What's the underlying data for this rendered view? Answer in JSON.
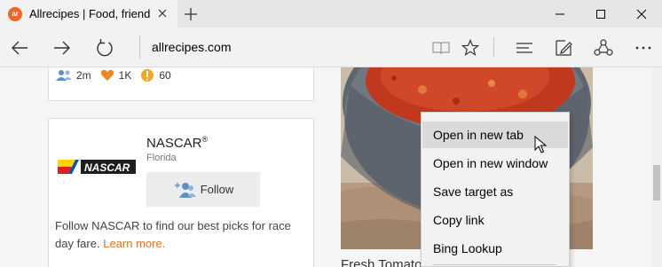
{
  "browser": {
    "tab": {
      "favicon": "allrecipes-logo-icon",
      "title": "Allrecipes | Food, friend"
    },
    "window_controls": [
      "minimize",
      "maximize",
      "close"
    ],
    "address": "allrecipes.com",
    "toolbar_icons": [
      "back-icon",
      "forward-icon",
      "refresh-icon",
      "reading-view-icon",
      "favorites-star-icon",
      "hub-icon",
      "web-note-icon",
      "share-icon",
      "more-icon"
    ]
  },
  "page": {
    "top_card_stats": [
      {
        "icon": "followers-icon",
        "value": "2m"
      },
      {
        "icon": "heart-icon",
        "value": "1K"
      },
      {
        "icon": "badge-icon",
        "value": "60"
      }
    ],
    "brand_card": {
      "logo_text": "NASCAR",
      "name": "NASCAR",
      "trademark": "®",
      "location": "Florida",
      "follow_label": "Follow",
      "description": "Follow NASCAR to find our best picks for race day fare.",
      "learn_more": "Learn more."
    },
    "recipe_caption": "Fresh Tomato"
  },
  "context_menu": {
    "items": [
      {
        "label": "Open in new tab",
        "hovered": true
      },
      {
        "label": "Open in new window",
        "hovered": false
      },
      {
        "label": "Save target as",
        "hovered": false
      },
      {
        "label": "Copy link",
        "hovered": false
      },
      {
        "label": "Bing Lookup",
        "hovered": false
      }
    ]
  },
  "colors": {
    "accent_orange": "#e8711c",
    "follower_blue": "#5b8fc7",
    "heart_orange": "#f0861f",
    "badge_orange": "#f5a623"
  }
}
